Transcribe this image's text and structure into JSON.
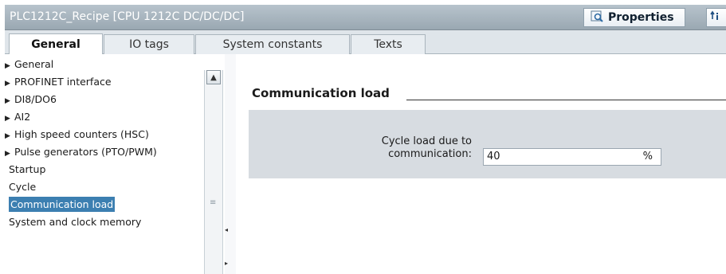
{
  "window": {
    "title": "PLC1212C_Recipe [CPU 1212C DC/DC/DC]",
    "properties_label": "Properties"
  },
  "tabs": [
    {
      "label": "General",
      "active": true
    },
    {
      "label": "IO tags",
      "active": false
    },
    {
      "label": "System constants",
      "active": false
    },
    {
      "label": "Texts",
      "active": false
    }
  ],
  "tree": {
    "items": [
      {
        "label": "General",
        "expandable": true
      },
      {
        "label": "PROFINET interface",
        "expandable": true
      },
      {
        "label": "DI8/DO6",
        "expandable": true
      },
      {
        "label": "AI2",
        "expandable": true
      },
      {
        "label": "High speed counters (HSC)",
        "expandable": true
      },
      {
        "label": "Pulse generators (PTO/PWM)",
        "expandable": true
      },
      {
        "label": "Startup",
        "expandable": false
      },
      {
        "label": "Cycle",
        "expandable": false
      },
      {
        "label": "Communication load",
        "expandable": false,
        "selected": true
      },
      {
        "label": "System and clock memory",
        "expandable": false
      }
    ]
  },
  "section": {
    "title": "Communication load",
    "field_label_line1": "Cycle load due to",
    "field_label_line2": "communication:",
    "field_value": "40",
    "field_unit": "%"
  },
  "colors": {
    "selection": "#3c7fb1",
    "titlebar": "#9aa8b2",
    "panel": "#d7dce1"
  }
}
